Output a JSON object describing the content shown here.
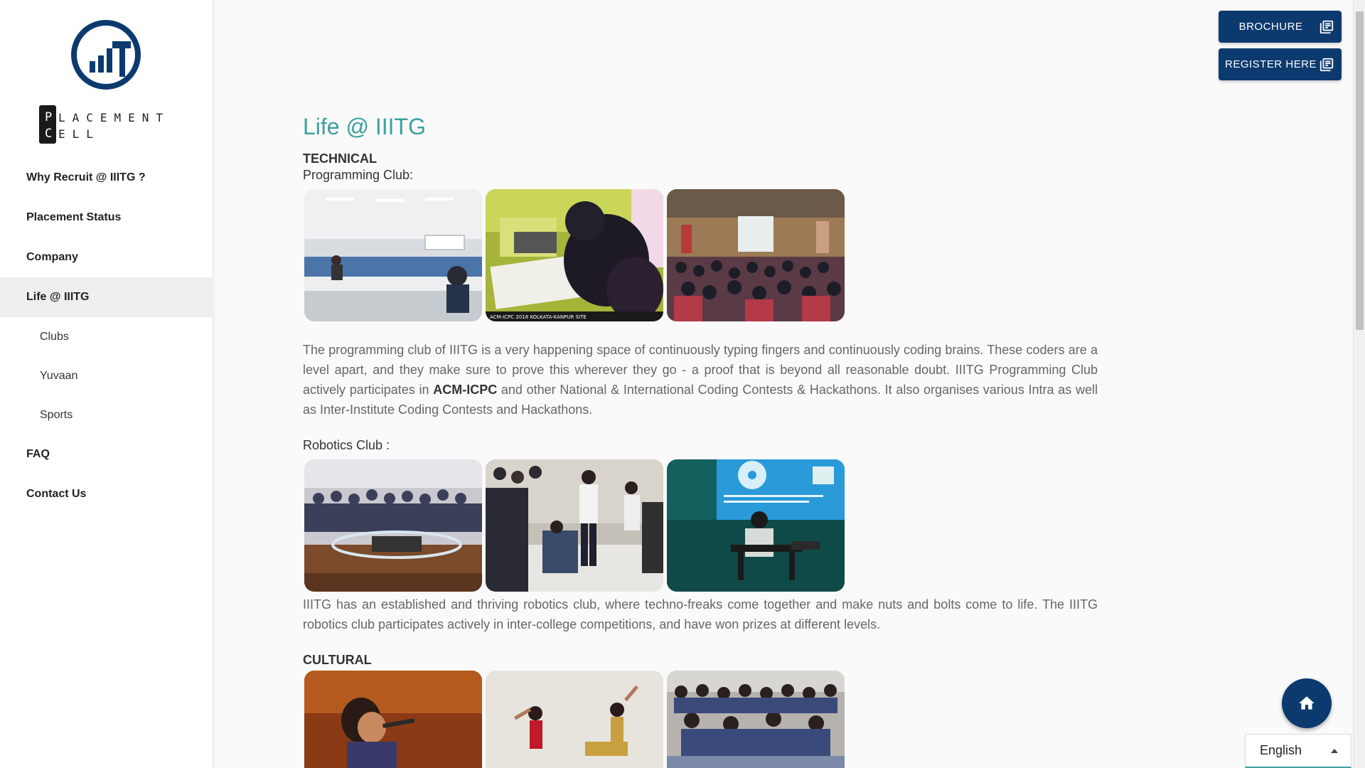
{
  "brand": {
    "wordmark_row1_first": "P",
    "wordmark_row1_rest": "LACEMENT",
    "wordmark_row2_first": "C",
    "wordmark_row2_rest": "ELL",
    "logo_color": "#0d3a6e"
  },
  "sidebar": {
    "items": [
      {
        "label": "Why Recruit @ IIITG ?"
      },
      {
        "label": "Placement Status"
      },
      {
        "label": "Company"
      },
      {
        "label": "Life @ IIITG",
        "active": true
      },
      {
        "label": "Clubs",
        "sub": true
      },
      {
        "label": "Yuvaan",
        "sub": true
      },
      {
        "label": "Sports",
        "sub": true
      },
      {
        "label": "FAQ"
      },
      {
        "label": "Contact Us"
      }
    ]
  },
  "header_buttons": {
    "brochure": {
      "label": "BROCHURE",
      "icon": "library-books-icon"
    },
    "register": {
      "label": "REGISTER HERE",
      "icon": "library-books-icon"
    }
  },
  "main": {
    "title": "Life @ IIITG",
    "technical": {
      "heading": "TECHNICAL",
      "programming_label": "Programming Club:",
      "programming_photo_caption": "ACM-ICPC 2018 KOLKATA-KANPUR SITE",
      "programming_para_1": "The programming club of IIITG is a very happening space of continuously typing fingers and continuously coding brains. These coders are a level apart, and they make sure to prove this wherever they go - a proof that is beyond all reasonable doubt. IIITG Programming Club actively participates in ",
      "programming_para_bold": "ACM-ICPC",
      "programming_para_2": " and other National & International Coding Contests & Hackathons. It also organises various Intra as well as Inter-Institute Coding Contests and Hackathons.",
      "robotics_label": "Robotics Club :",
      "robotics_para": "IIITG has an established and thriving robotics club, where techno-freaks come together and make nuts and bolts come to life. The IIITG robotics club participates actively in inter-college competitions, and have won prizes at different levels."
    },
    "cultural": {
      "heading": "CULTURAL"
    }
  },
  "fab": {
    "icon": "home-icon"
  },
  "language": {
    "selected": "English"
  },
  "colors": {
    "accent": "#3aa0a0",
    "primary": "#0d3a6e"
  }
}
